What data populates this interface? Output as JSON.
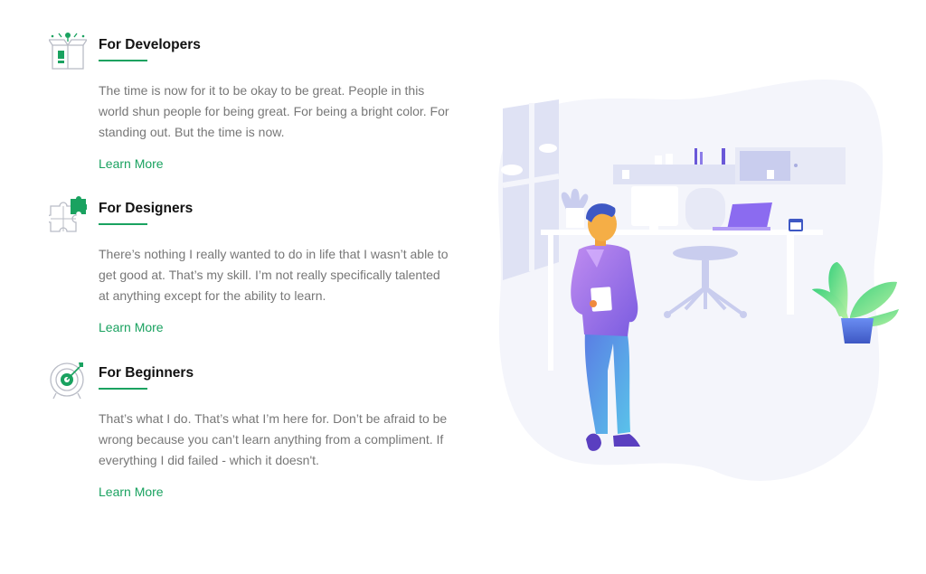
{
  "colors": {
    "accent": "#1aa260",
    "heading": "#111111",
    "body_text": "#777777",
    "illustration_bg": "#f4f5fb"
  },
  "features": [
    {
      "icon": "open-box-icon",
      "title": "For Developers",
      "description": "The time is now for it to be okay to be great. People in this world shun people for being great. For being a bright color. For standing out. But the time is now.",
      "link": "Learn More"
    },
    {
      "icon": "puzzle-icon",
      "title": "For Designers",
      "description": "There’s nothing I really wanted to do in life that I wasn’t able to get good at. That’s my skill. I’m not really specifically talented at anything except for the ability to learn.",
      "link": "Learn More"
    },
    {
      "icon": "target-icon",
      "title": "For Beginners",
      "description": "That’s what I do. That’s what I’m here for. Don’t be afraid to be wrong because you can’t learn anything from a compliment. If everything I did failed - which it doesn't.",
      "link": "Learn More"
    }
  ],
  "illustration": {
    "icon": "office-person-illustration"
  }
}
